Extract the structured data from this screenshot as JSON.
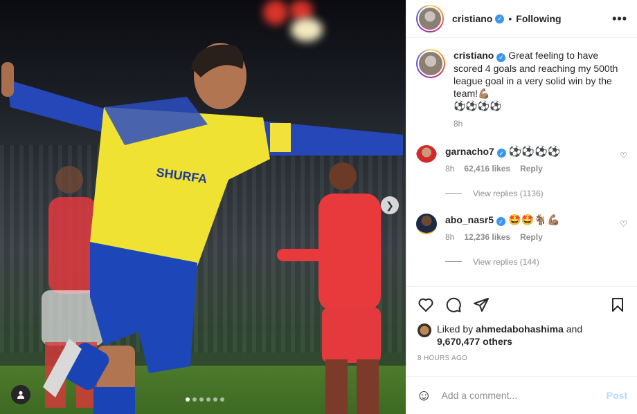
{
  "header": {
    "username": "cristiano",
    "separator": "•",
    "follow_status": "Following",
    "more_label": "•••"
  },
  "caption": {
    "username": "cristiano",
    "text": "Great feeling to have scored 4 goals and reaching my 500th league goal in a very solid win by the team!💪🏽",
    "emoji_line": "⚽⚽⚽⚽",
    "time": "8h"
  },
  "comments": [
    {
      "username": "garnacho7",
      "text": "⚽⚽⚽⚽",
      "time": "8h",
      "likes": "62,416 likes",
      "reply_label": "Reply",
      "view_replies": "View replies (1136)"
    },
    {
      "username": "abo_nasr5",
      "text": "🤩🤩🐐💪🏽",
      "time": "8h",
      "likes": "12,236 likes",
      "reply_label": "Reply",
      "view_replies": "View replies (144)"
    }
  ],
  "likes": {
    "prefix": "Liked by",
    "user": "ahmedabohashima",
    "mid": "and",
    "others": "9,670,477 others"
  },
  "timestamp": "8 HOURS AGO",
  "add_comment": {
    "placeholder": "Add a comment...",
    "post_label": "Post"
  },
  "carousel": {
    "count": 6,
    "active_index": 0
  },
  "icons": {
    "verified": "verified-badge-icon",
    "heart": "heart-icon",
    "comment": "comment-icon",
    "share": "share-icon",
    "save": "bookmark-icon",
    "emoji": "emoji-icon",
    "next": "chevron-right-icon",
    "tag": "user-tag-icon"
  },
  "colors": {
    "accent": "#3897f0",
    "post_disabled": "#b3dbff",
    "muted": "#8e8e8e"
  }
}
